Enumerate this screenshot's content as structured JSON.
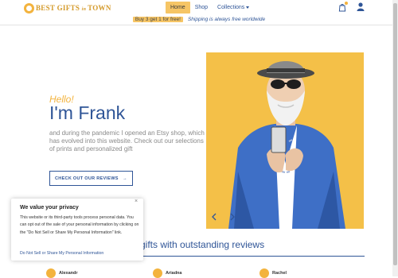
{
  "brand": {
    "logo_text_1": "BEST ",
    "logo_text_2": "GIFTS ",
    "logo_text_3": "in ",
    "logo_text_4": "TOWN"
  },
  "nav": {
    "items": [
      {
        "label": "Home",
        "active": true
      },
      {
        "label": "Shop",
        "active": false
      },
      {
        "label": "Collections",
        "active": false
      }
    ]
  },
  "promo": {
    "offer": "Buy 3 get 1 for free!",
    "shipping": "Shipping is always free worldwide"
  },
  "hero": {
    "hello": "Hello!",
    "im": "I'm",
    "name": " Frank",
    "subtitle": "and during the pandemic I opened an Etsy shop, which has evolved into this website. Check out our selections of prints and personalized gift",
    "cta": "CHECK OUT OUR REVIEWS",
    "cta_arrow": "→"
  },
  "section": {
    "title": "gifts with outstanding reviews"
  },
  "reviewers": [
    {
      "name": "Alexandr"
    },
    {
      "name": "Ariadna"
    },
    {
      "name": "Rachel"
    }
  ],
  "cookie": {
    "title": "We value your privacy",
    "body": "This website or its third-party tools process personal data. You can opt out of the sale of your personal information by clicking on the \"Do Not Sell or Share My Personal Information\" link.",
    "link": "Do Not Sell or Share My Personal Information",
    "close": "×"
  },
  "colors": {
    "accent": "#f6c565",
    "primary": "#2f5597",
    "hero_bg": "#f4c048"
  },
  "icons": {
    "cart": "cart-icon",
    "user": "user-icon",
    "prev": "chevron-left-icon",
    "next": "chevron-right-icon"
  }
}
